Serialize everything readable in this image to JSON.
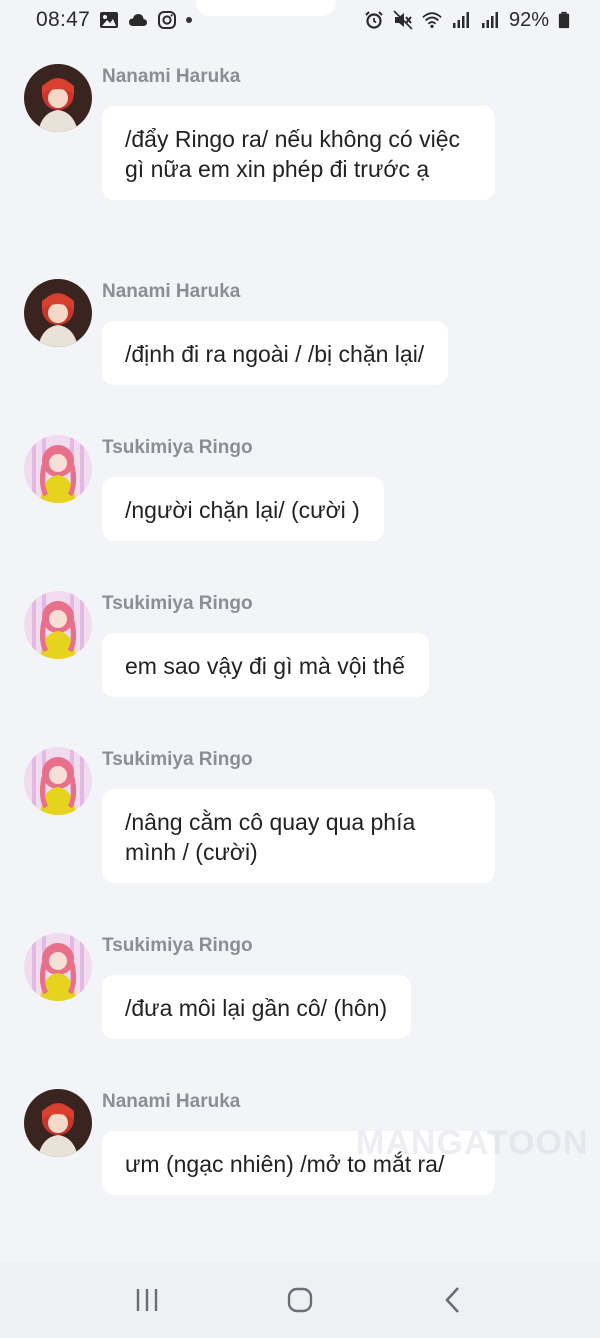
{
  "status_bar": {
    "time": "08:47",
    "battery_text": "92%",
    "left_icons": [
      "gallery-icon",
      "cloud-icon",
      "instagram-icon",
      "notification-dot-icon"
    ],
    "right_icons": [
      "alarm-icon",
      "mute-icon",
      "wifi-icon",
      "signal-icon",
      "signal-icon",
      "battery-icon"
    ]
  },
  "messages": [
    {
      "sender": "Nanami Haruka",
      "avatar": "nanami-avatar",
      "text": "/đẩy Ringo ra/ nếu không có việc gì nữa em xin phép đi trước ạ"
    },
    {
      "sender": "Nanami Haruka",
      "avatar": "nanami-avatar",
      "text": "/định đi ra ngoài / /bị chặn lại/"
    },
    {
      "sender": "Tsukimiya Ringo",
      "avatar": "ringo-avatar",
      "text": "/người chặn lại/ (cười )"
    },
    {
      "sender": "Tsukimiya Ringo",
      "avatar": "ringo-avatar",
      "text": "em sao vậy đi gì mà vội thế"
    },
    {
      "sender": "Tsukimiya Ringo",
      "avatar": "ringo-avatar",
      "text": "/nâng cằm cô quay qua phía mình / (cười)"
    },
    {
      "sender": "Tsukimiya Ringo",
      "avatar": "ringo-avatar",
      "text": "/đưa môi lại gần cô/ (hôn)"
    },
    {
      "sender": "Nanami Haruka",
      "avatar": "nanami-avatar",
      "text": "ưm (ngạc nhiên) /mở to mắt ra/"
    }
  ],
  "watermark": "MANGATOON",
  "nav_bar": {
    "icons": [
      "recent-apps-icon",
      "home-icon",
      "back-icon"
    ]
  },
  "colors": {
    "background": "#f3f4f8",
    "bubble": "#ffffff",
    "sender_name": "#8b8e96",
    "text": "#222222"
  }
}
